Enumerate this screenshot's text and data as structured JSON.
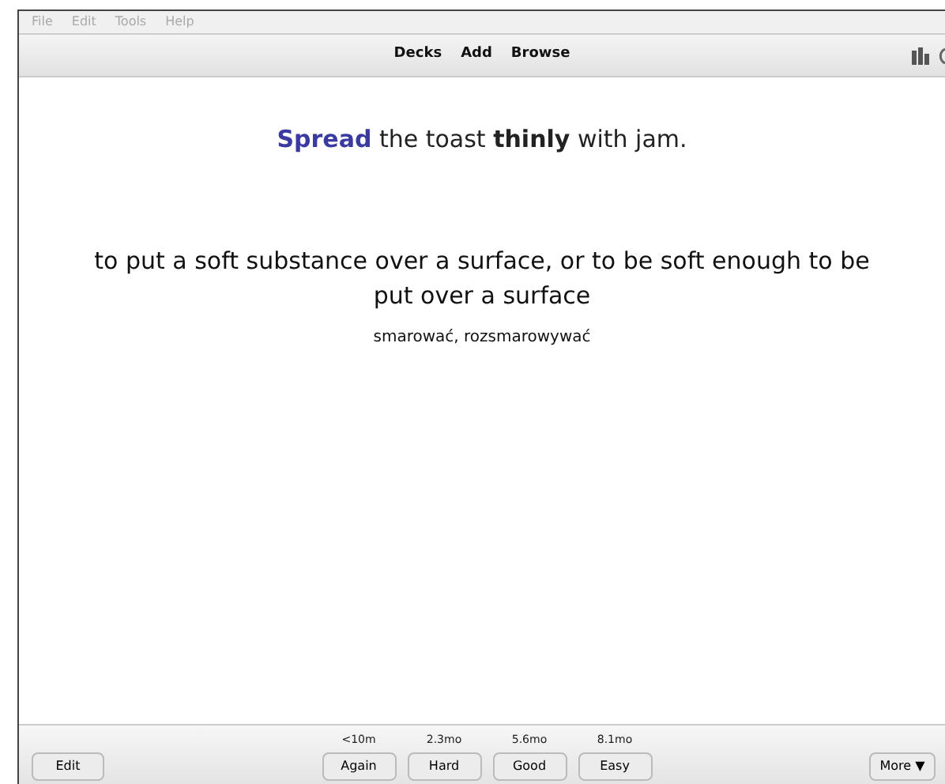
{
  "menu_bar": [
    "File",
    "Edit",
    "Tools",
    "Help"
  ],
  "toolbar": {
    "links": [
      "Decks",
      "Add",
      "Browse"
    ]
  },
  "card": {
    "keyword": "Spread",
    "sentence": "the toast **thinly** with jam.",
    "definition": "to put a soft substance over a surface, or to be soft enough to be put over a surface",
    "translation": "smarować, rozsmarowywać"
  },
  "bottom_bar": {
    "edit_button": "Edit",
    "answers": [
      {
        "interval": "<10m",
        "label": "Again"
      },
      {
        "interval": "2.3mo",
        "label": "Hard"
      },
      {
        "interval": "5.6mo",
        "label": "Good"
      },
      {
        "interval": "8.1mo",
        "label": "Easy"
      }
    ],
    "more_button": "More ▼"
  }
}
